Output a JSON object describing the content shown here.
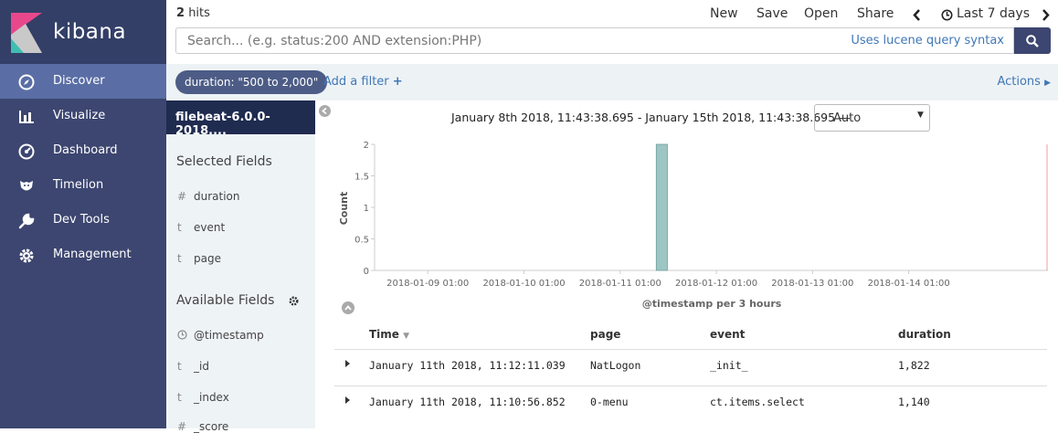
{
  "app": {
    "brand": "kibana"
  },
  "nav": {
    "items": [
      {
        "label": "Discover",
        "icon": "compass-icon",
        "active": true
      },
      {
        "label": "Visualize",
        "icon": "bar-chart-icon"
      },
      {
        "label": "Dashboard",
        "icon": "dashboard-icon"
      },
      {
        "label": "Timelion",
        "icon": "timelion-icon"
      },
      {
        "label": "Dev Tools",
        "icon": "wrench-icon"
      },
      {
        "label": "Management",
        "icon": "gear-icon"
      }
    ]
  },
  "topbar": {
    "hits_count": "2",
    "hits_label": "hits",
    "new": "New",
    "save": "Save",
    "open": "Open",
    "share": "Share",
    "time_range": "Last 7 days"
  },
  "search": {
    "placeholder": "Search... (e.g. status:200 AND extension:PHP)",
    "syntax_link": "Uses lucene query syntax"
  },
  "filters": {
    "pill": "duration: \"500 to 2,000\"",
    "add": "Add a filter",
    "actions": "Actions"
  },
  "sidebar": {
    "index_pattern": "filebeat-6.0.0-2018....",
    "selected_title": "Selected Fields",
    "selected_fields": [
      {
        "type": "#",
        "name": "duration"
      },
      {
        "type": "t",
        "name": "event"
      },
      {
        "type": "t",
        "name": "page"
      }
    ],
    "available_title": "Available Fields",
    "available_fields": [
      {
        "type": "clock",
        "name": "@timestamp"
      },
      {
        "type": "t",
        "name": "_id"
      },
      {
        "type": "t",
        "name": "_index"
      },
      {
        "type": "#",
        "name": "_score"
      }
    ]
  },
  "histogram": {
    "range_text": "January 8th 2018, 11:43:38.695 - January 15th 2018, 11:43:38.695 —",
    "interval": "Auto"
  },
  "chart_data": {
    "type": "bar",
    "ylabel": "Count",
    "xlabel": "@timestamp per 3 hours",
    "y_ticks": [
      "0",
      "0.5",
      "1",
      "1.5",
      "2"
    ],
    "ylim": [
      0,
      2
    ],
    "x_ticks": [
      "2018-01-09 01:00",
      "2018-01-10 01:00",
      "2018-01-11 01:00",
      "2018-01-12 01:00",
      "2018-01-13 01:00",
      "2018-01-14 01:00"
    ],
    "bars": [
      {
        "bucket": "2018-01-11 10:00",
        "value": 2
      }
    ],
    "bar_color": "#9cc5c4"
  },
  "table": {
    "headers": {
      "time": "Time",
      "page": "page",
      "event": "event",
      "duration": "duration"
    },
    "rows": [
      {
        "time": "January 11th 2018, 11:12:11.039",
        "page": "NatLogon",
        "event": "_init_",
        "duration": "1,822"
      },
      {
        "time": "January 11th 2018, 11:10:56.852",
        "page": "0-menu",
        "event": "ct.items.select",
        "duration": "1,140"
      }
    ]
  }
}
